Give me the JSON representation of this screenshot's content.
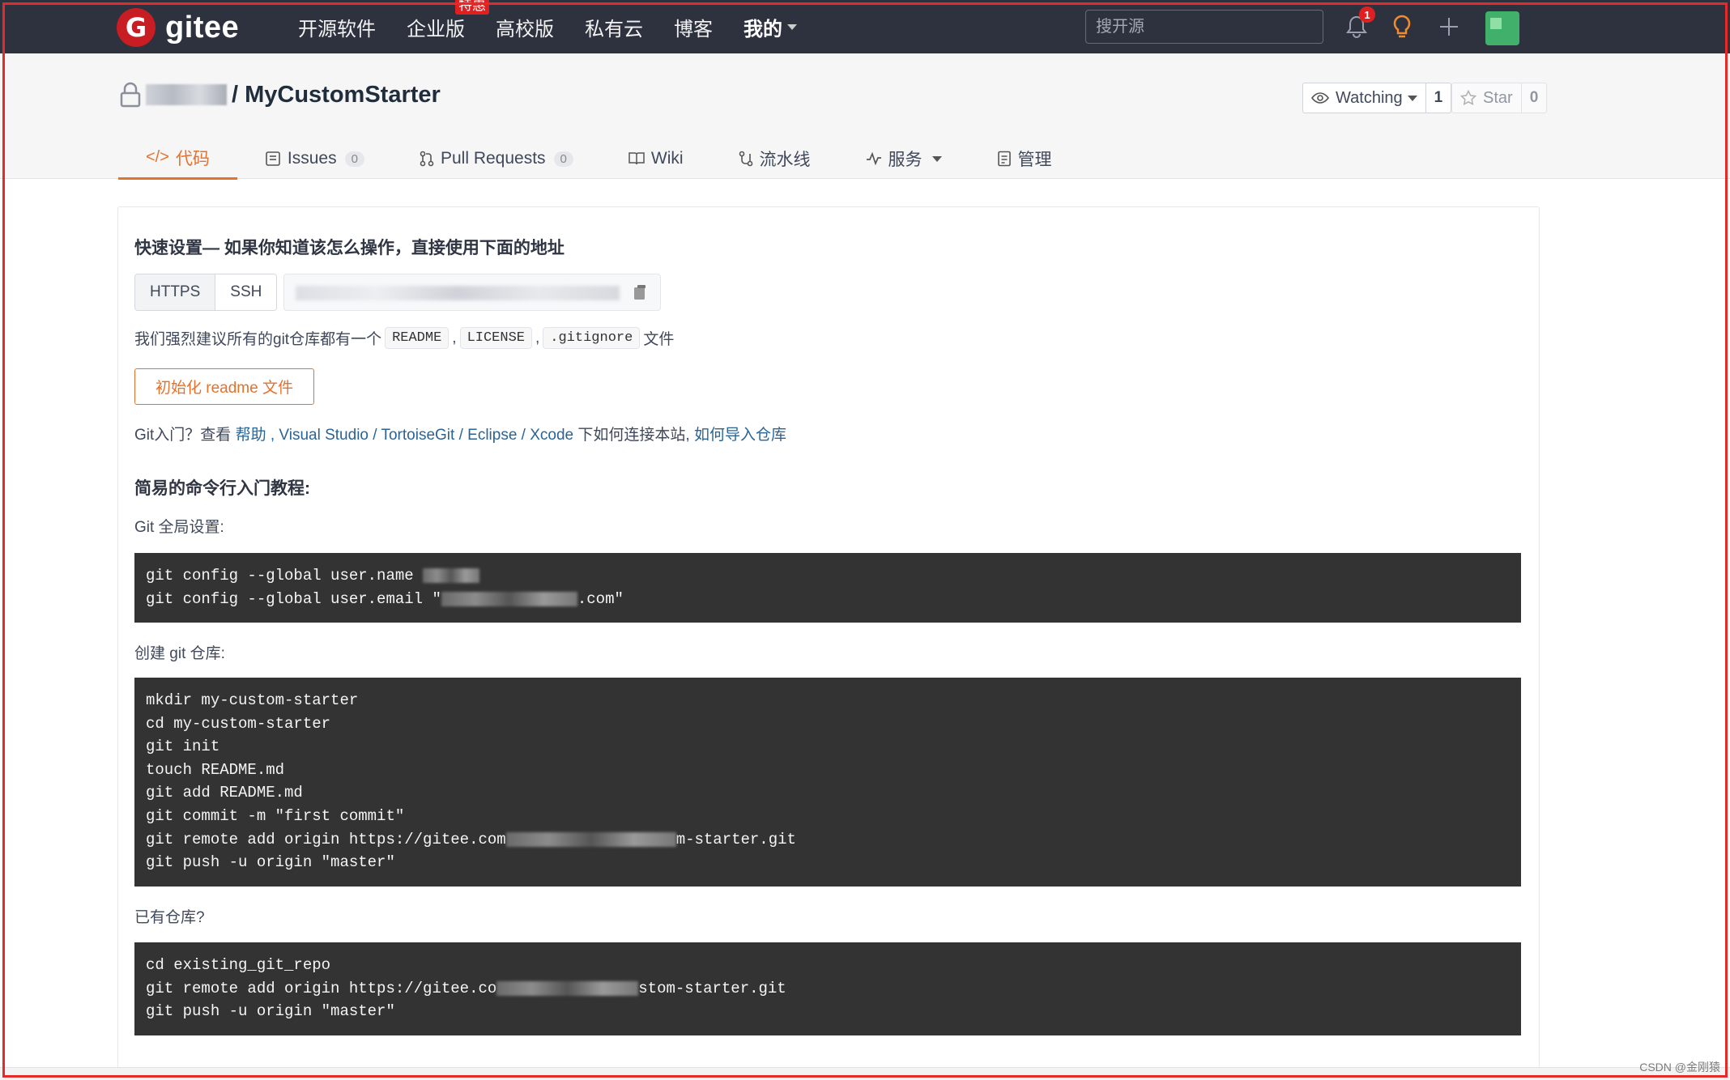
{
  "brand": {
    "logo_letter": "G",
    "name": "gitee"
  },
  "nav": {
    "items": [
      "开源软件",
      "企业版",
      "高校版",
      "私有云",
      "博客",
      "我的"
    ],
    "enterprise_badge": "特惠"
  },
  "search": {
    "placeholder": "搜开源"
  },
  "notifications": {
    "count": "1"
  },
  "repo": {
    "name": "/ MyCustomStarter",
    "watch_label": "Watching",
    "watch_count": "1",
    "star_label": "Star",
    "star_count": "0"
  },
  "tabs": [
    {
      "label": "代码",
      "icon": "code-icon"
    },
    {
      "label": "Issues",
      "count": "0",
      "icon": "issues-icon"
    },
    {
      "label": "Pull Requests",
      "count": "0",
      "icon": "pull-request-icon"
    },
    {
      "label": "Wiki",
      "icon": "wiki-icon"
    },
    {
      "label": "流水线",
      "icon": "pipeline-icon"
    },
    {
      "label": "服务",
      "icon": "service-icon"
    },
    {
      "label": "管理",
      "icon": "manage-icon"
    }
  ],
  "setup": {
    "title": "快速设置— 如果你知道该怎么操作，直接使用下面的地址",
    "protocols": [
      "HTTPS",
      "SSH"
    ],
    "recommend_prefix": "我们强烈建议所有的git仓库都有一个",
    "files": [
      "README",
      "LICENSE",
      ".gitignore"
    ],
    "recommend_suffix": "文件",
    "init_button": "初始化 readme 文件",
    "help_prefix": "Git入门？查看",
    "help_link": "帮助",
    "tools": [
      "Visual Studio",
      "TortoiseGit",
      "Eclipse",
      "Xcode"
    ],
    "help_middle": "下如何连接本站,",
    "import_link": "如何导入仓库"
  },
  "tutorial": {
    "title": "简易的命令行入门教程:",
    "global_label": "Git 全局设置:",
    "global_lines": [
      "git config --global user.name ",
      "git config --global user.email \"",
      ".com\""
    ],
    "create_label": "创建 git 仓库:",
    "create_lines": [
      "mkdir my-custom-starter",
      "cd my-custom-starter",
      "git init",
      "touch README.md",
      "git add README.md",
      "git commit -m \"first commit\"",
      "git remote add origin https://gitee.com",
      "m-starter.git",
      "git push -u origin \"master\""
    ],
    "existing_label": "已有仓库?",
    "existing_lines": [
      "cd existing_git_repo",
      "git remote add origin https://gitee.co",
      "stom-starter.git",
      "git push -u origin \"master\""
    ]
  },
  "watermark": "CSDN @金刚猿",
  "colors": {
    "accent": "#e6712c",
    "nav_bg": "#2e323e",
    "code_bg": "#333333",
    "link": "#2a6496",
    "brand_red": "#c71d23"
  }
}
